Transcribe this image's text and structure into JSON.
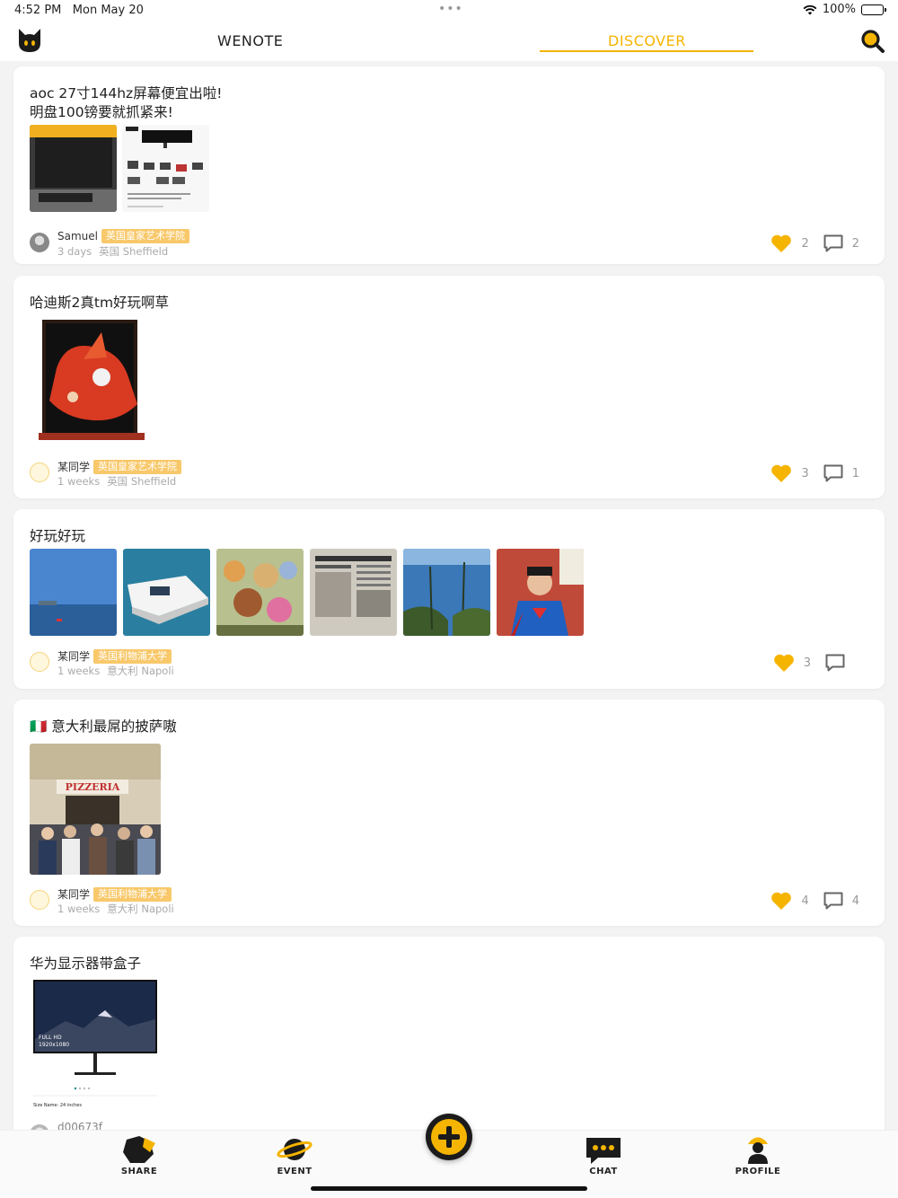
{
  "status_bar": {
    "time": "4:52 PM",
    "date": "Mon May 20",
    "battery": "100%"
  },
  "header": {
    "logo_icon": "cat-logo-icon",
    "tabs": [
      {
        "label": "WENOTE",
        "active": false
      },
      {
        "label": "DISCOVER",
        "active": true
      }
    ],
    "search_icon": "search-icon"
  },
  "colors": {
    "accent": "#f5b400",
    "badge": "#f8c86a",
    "dark": "#1b1b1b"
  },
  "posts": [
    {
      "title_lines": [
        "aoc 27寸144hz屏幕便宜出啦!",
        "明盘100镑要就抓紧来!"
      ],
      "images": [
        "monitor-photo",
        "monitor-listing-screenshot"
      ],
      "user": "Samuel",
      "badge": "英国皇家艺术学院",
      "time": "3 days",
      "location": "英国 Sheffield",
      "likes": "2",
      "comments": "2"
    },
    {
      "title_lines": [
        "哈迪斯2真tm好玩啊草"
      ],
      "images": [
        "game-artwork"
      ],
      "user": "某同学",
      "badge": "英国皇家艺术学院",
      "time": "1 weeks",
      "location": "英国 Sheffield",
      "likes": "3",
      "comments": "1"
    },
    {
      "title_lines": [
        "好玩好玩"
      ],
      "images": [
        "sea-horizon",
        "boat-on-water",
        "market-stall",
        "newspaper",
        "coastal-trees",
        "superman-statue"
      ],
      "user": "某同学",
      "badge": "英国利物浦大学",
      "time": "1 weeks",
      "location": "意大利 Napoli",
      "likes": "3",
      "comments": ""
    },
    {
      "title_lines": [
        "🇮🇹 意大利最屌的披萨嗷"
      ],
      "images": [
        "pizzeria-storefront"
      ],
      "user": "某同学",
      "badge": "英国利物浦大学",
      "time": "1 weeks",
      "location": "意大利 Napoli",
      "likes": "4",
      "comments": "4"
    },
    {
      "title_lines": [
        "华为显示器带盒子"
      ],
      "images": [
        "huawei-monitor-listing"
      ],
      "user": "d00673f",
      "badge": "",
      "time": "",
      "location": "",
      "likes": "",
      "comments": ""
    }
  ],
  "monitor_overlay": {
    "line1": "FULL HD",
    "line2": "1920x1080",
    "size": "Size Name: 24 inches"
  },
  "tab_bar": {
    "items": [
      {
        "label": "SHARE",
        "icon": "share-icon"
      },
      {
        "label": "EVENT",
        "icon": "planet-icon"
      },
      {
        "label": "CHAT",
        "icon": "chat-bubble-icon"
      },
      {
        "label": "PROFILE",
        "icon": "person-icon"
      }
    ],
    "add_icon": "add-icon"
  }
}
